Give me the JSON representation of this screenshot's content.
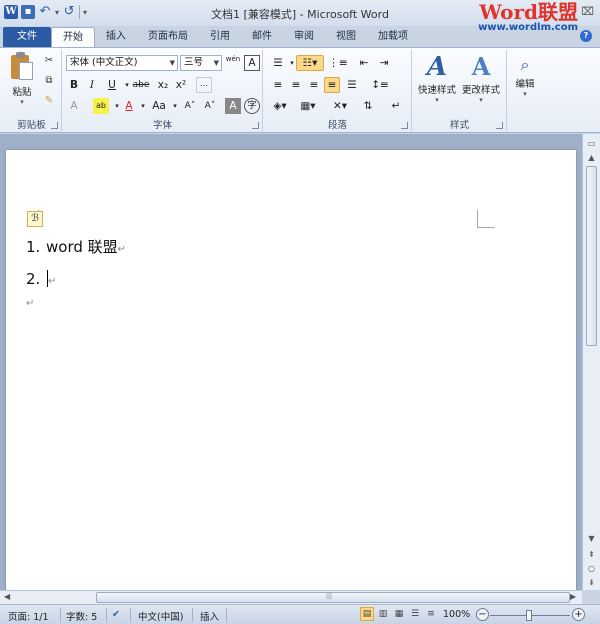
{
  "window": {
    "title": "文档1 [兼容模式] - Microsoft Word",
    "brand_main_a": "Word",
    "brand_main_b": "联盟",
    "brand_url": "www.wordlm.com",
    "close_glyph": "⌧",
    "help_glyph": "?"
  },
  "qat": {
    "word_icon": "W",
    "save_icon": "save-icon",
    "undo_glyph": "↶",
    "redo_glyph": "↺",
    "dd": "▾"
  },
  "tabs": [
    "文件",
    "开始",
    "插入",
    "页面布局",
    "引用",
    "邮件",
    "审阅",
    "视图",
    "加载项"
  ],
  "active_tab": "开始",
  "ribbon": {
    "clipboard": {
      "label": "剪贴板",
      "paste": "粘贴"
    },
    "font": {
      "label": "字体",
      "font_name": "宋体 (中文正文)",
      "font_size": "三号",
      "bold": "B",
      "italic": "I",
      "underline": "U",
      "strike": "abe",
      "sub": "x₂",
      "sup": "x²",
      "grow": "A˄",
      "shrink": "A˅",
      "case": "Aa",
      "wen": "wén",
      "clear": "A",
      "char_border": "A",
      "enclose": "字"
    },
    "paragraph": {
      "label": "段落"
    },
    "styles": {
      "label": "样式",
      "quick": "快速样式",
      "change": "更改样式"
    },
    "editing": {
      "label": "编辑"
    }
  },
  "document": {
    "list_items": [
      {
        "number": "1.",
        "text": "word 联盟"
      },
      {
        "number": "2.",
        "text": ""
      }
    ],
    "para_mark": "↵",
    "autocorrect_glyph": "ℬ"
  },
  "status": {
    "page": "页面: 1/1",
    "words": "字数: 5",
    "language": "中文(中国)",
    "mode": "插入",
    "zoom": "100%",
    "zoom_minus": "−",
    "zoom_plus": "+"
  },
  "colors": {
    "file_tab": "#2b5ba5",
    "brand_red": "#e0332c",
    "brand_blue": "#1a54b0",
    "active_highlight": "#fbd98a",
    "workspace": "#9fafc5"
  }
}
